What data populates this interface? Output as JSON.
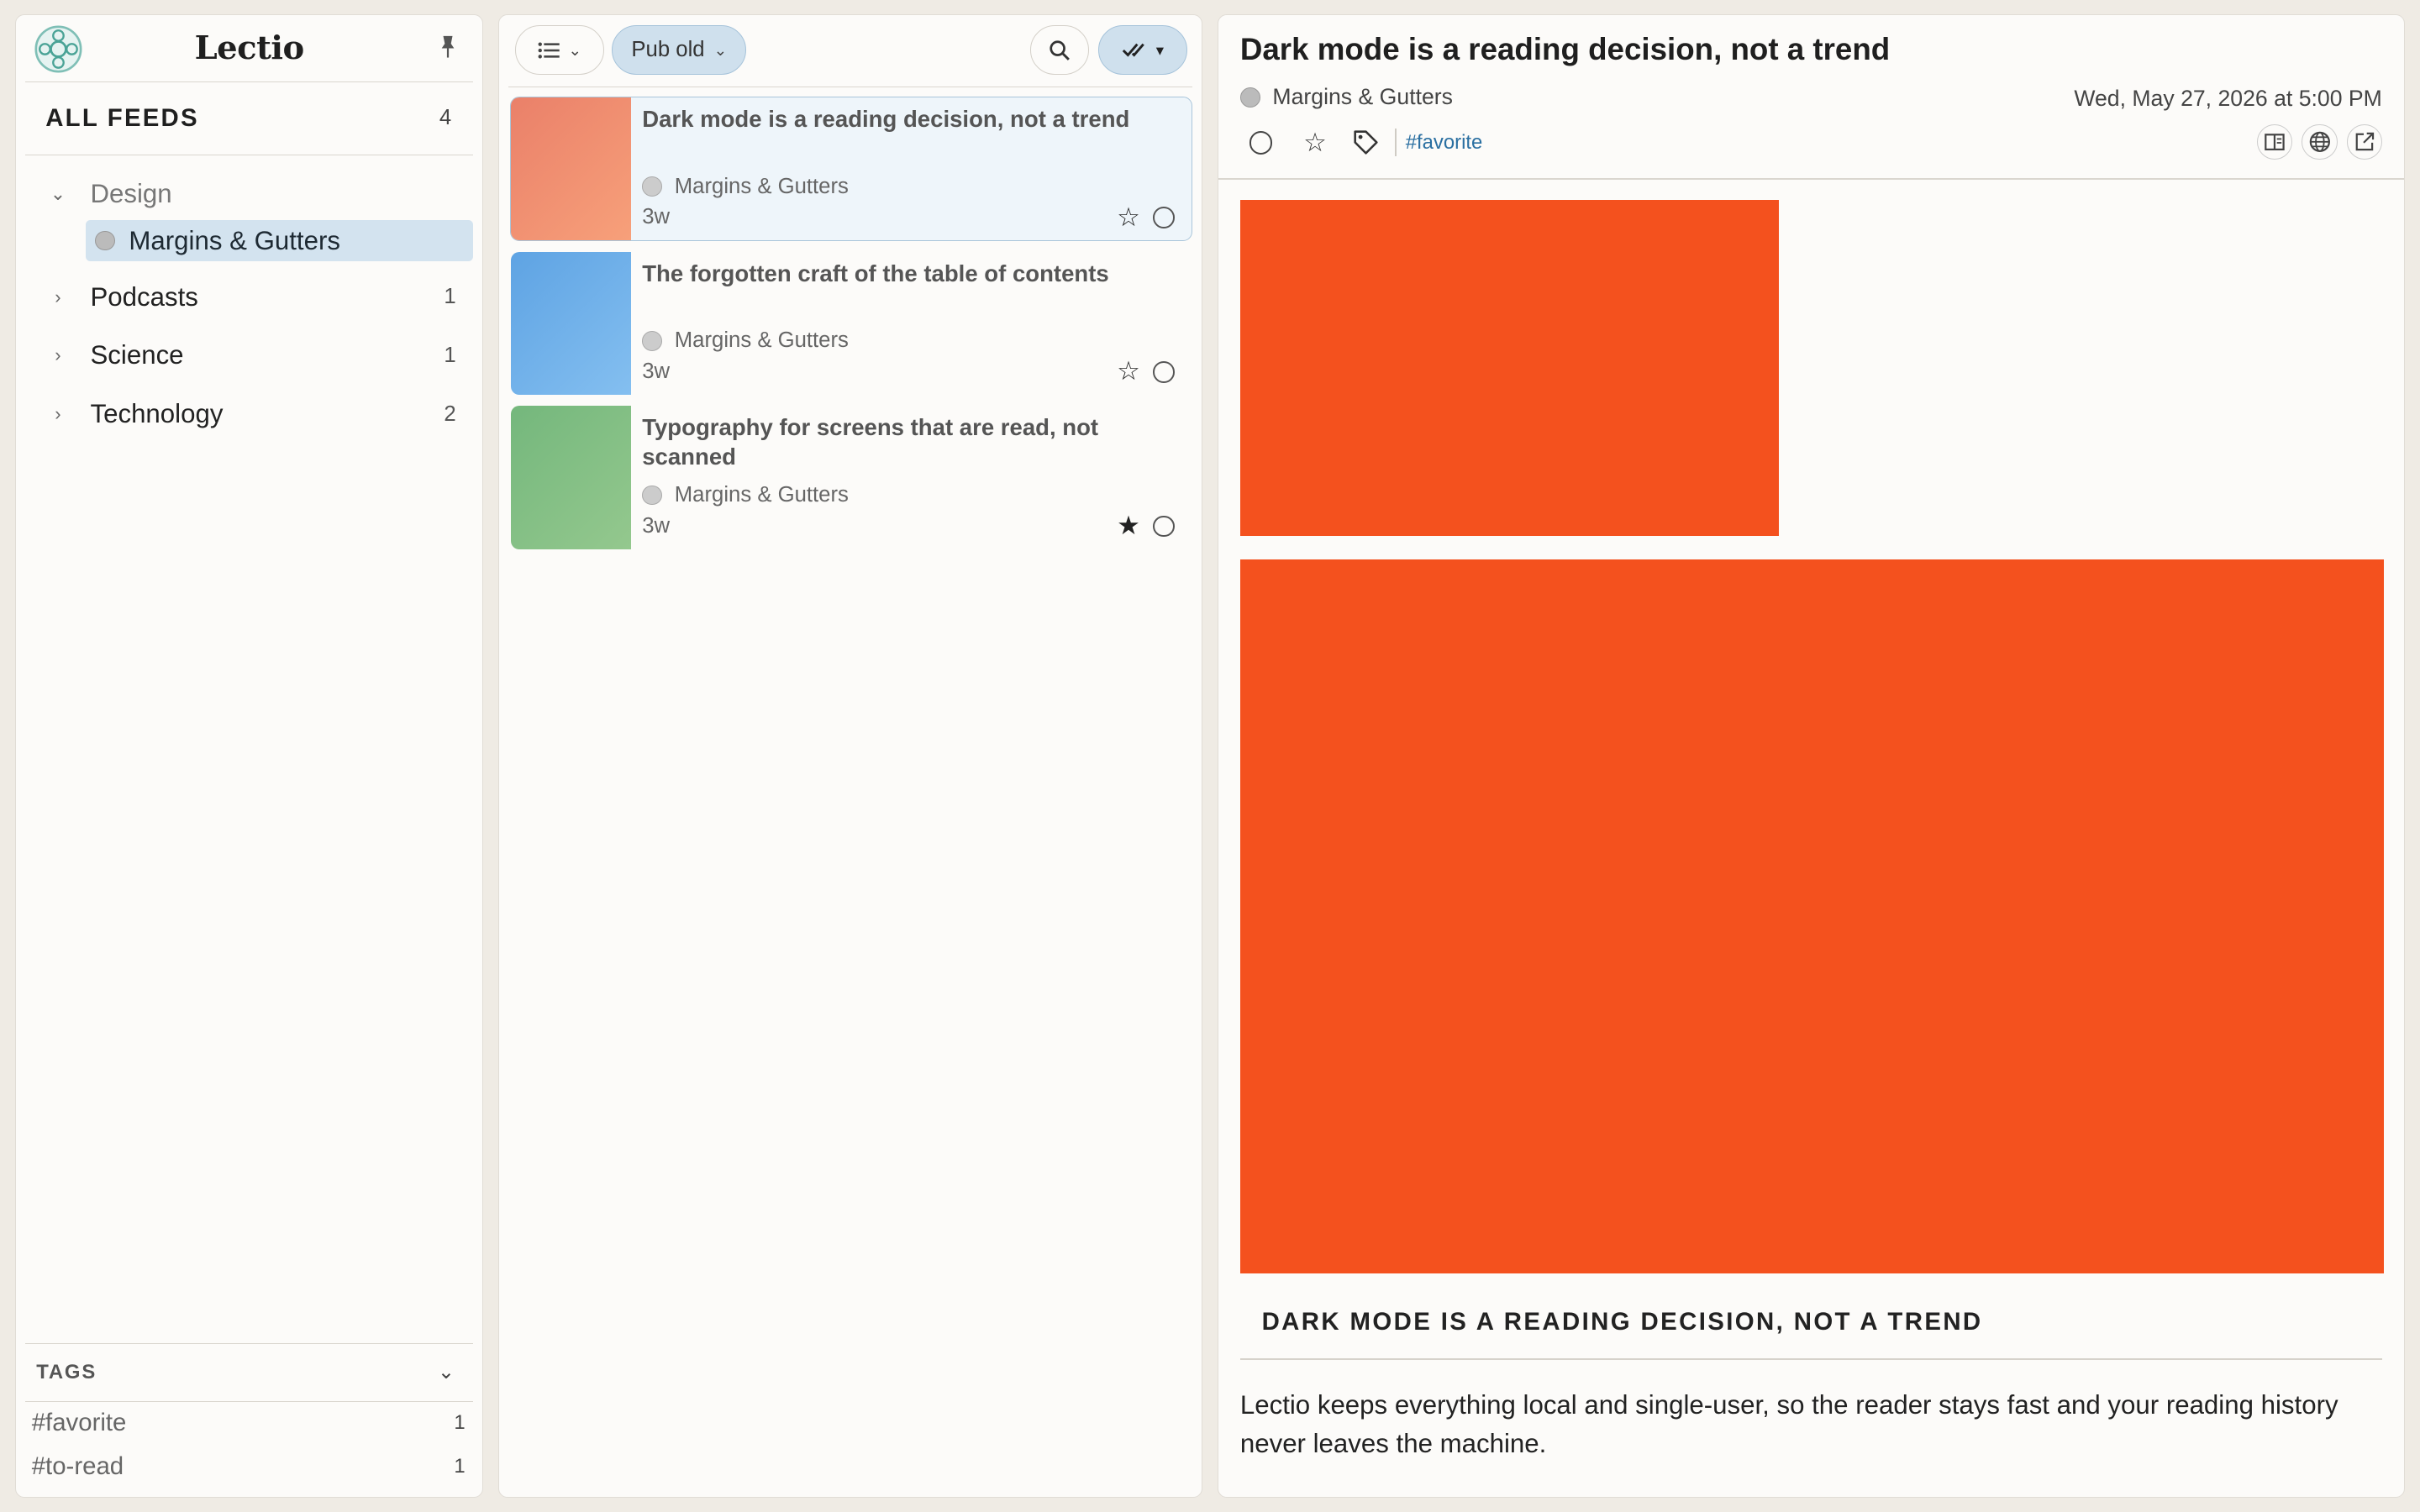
{
  "app": {
    "title": "Lectio",
    "pin_icon": "pin-icon",
    "logo_icon": "lectio-logo-icon"
  },
  "sidebar": {
    "all_feeds": {
      "label": "ALL FEEDS",
      "count": "4"
    },
    "categories": [
      {
        "name": "Design",
        "expanded": true,
        "count": "",
        "feeds": [
          {
            "name": "Margins & Gutters",
            "selected": true
          }
        ]
      },
      {
        "name": "Podcasts",
        "expanded": false,
        "count": "1"
      },
      {
        "name": "Science",
        "expanded": false,
        "count": "1"
      },
      {
        "name": "Technology",
        "expanded": false,
        "count": "2"
      }
    ],
    "tags": {
      "label": "TAGS",
      "items": [
        {
          "name": "#favorite",
          "count": "1"
        },
        {
          "name": "#to-read",
          "count": "1"
        }
      ]
    }
  },
  "list": {
    "toolbar": {
      "view_icon": "list-view-icon",
      "sort_label": "Pub old",
      "search_icon": "search-icon",
      "mark_read_icon": "double-check-icon"
    },
    "articles": [
      {
        "title": "Dark mode is a reading decision, not a trend",
        "feed": "Margins & Gutters",
        "age": "3w",
        "starred": false,
        "selected": true,
        "thumb_color": "#ef8a6b"
      },
      {
        "title": "The forgotten craft of the table of contents",
        "feed": "Margins & Gutters",
        "age": "3w",
        "starred": false,
        "selected": false,
        "thumb_color": "#6fb0e8"
      },
      {
        "title": "Typography for screens that are read, not scanned",
        "feed": "Margins & Gutters",
        "age": "3w",
        "starred": true,
        "selected": false,
        "thumb_color": "#84c08a"
      }
    ]
  },
  "reader": {
    "title": "Dark mode is a reading decision, not a trend",
    "feed": "Margins & Gutters",
    "date": "Wed, May 27, 2026 at 5:00 PM",
    "tag": "#favorite",
    "image_color": "#f4511e",
    "caption": "DARK MODE IS A READING DECISION, NOT A TREND",
    "body": "Lectio keeps everything local and single-user, so the reader stays fast and your reading history never leaves the machine."
  },
  "colors": {
    "accent": "#2a6fa1",
    "selection": "#d3e3ef",
    "background": "#efebe4"
  }
}
